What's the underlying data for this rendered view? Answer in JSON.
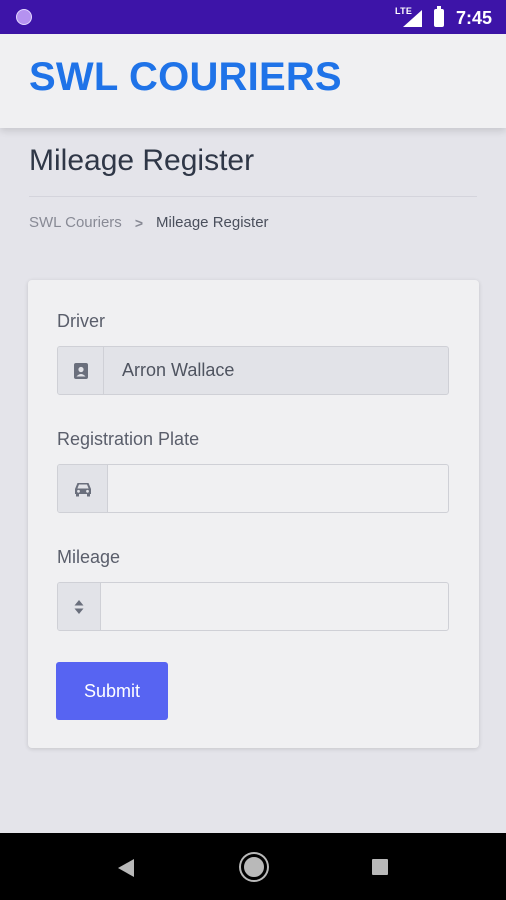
{
  "status_bar": {
    "network": "LTE",
    "time": "7:45"
  },
  "header": {
    "brand": "SWL COURIERS"
  },
  "page": {
    "title": "Mileage Register",
    "breadcrumb": {
      "home": "SWL Couriers",
      "separator": ">",
      "current": "Mileage Register"
    }
  },
  "form": {
    "driver": {
      "label": "Driver",
      "value": "Arron Wallace",
      "icon": "contact-card-icon"
    },
    "registration": {
      "label": "Registration Plate",
      "value": "",
      "icon": "car-icon"
    },
    "mileage": {
      "label": "Mileage",
      "value": "",
      "icon": "sort-icon"
    },
    "submit_label": "Submit"
  },
  "colors": {
    "status_bar": "#3d14a8",
    "brand": "#1f73e8",
    "submit": "#5764f2"
  }
}
